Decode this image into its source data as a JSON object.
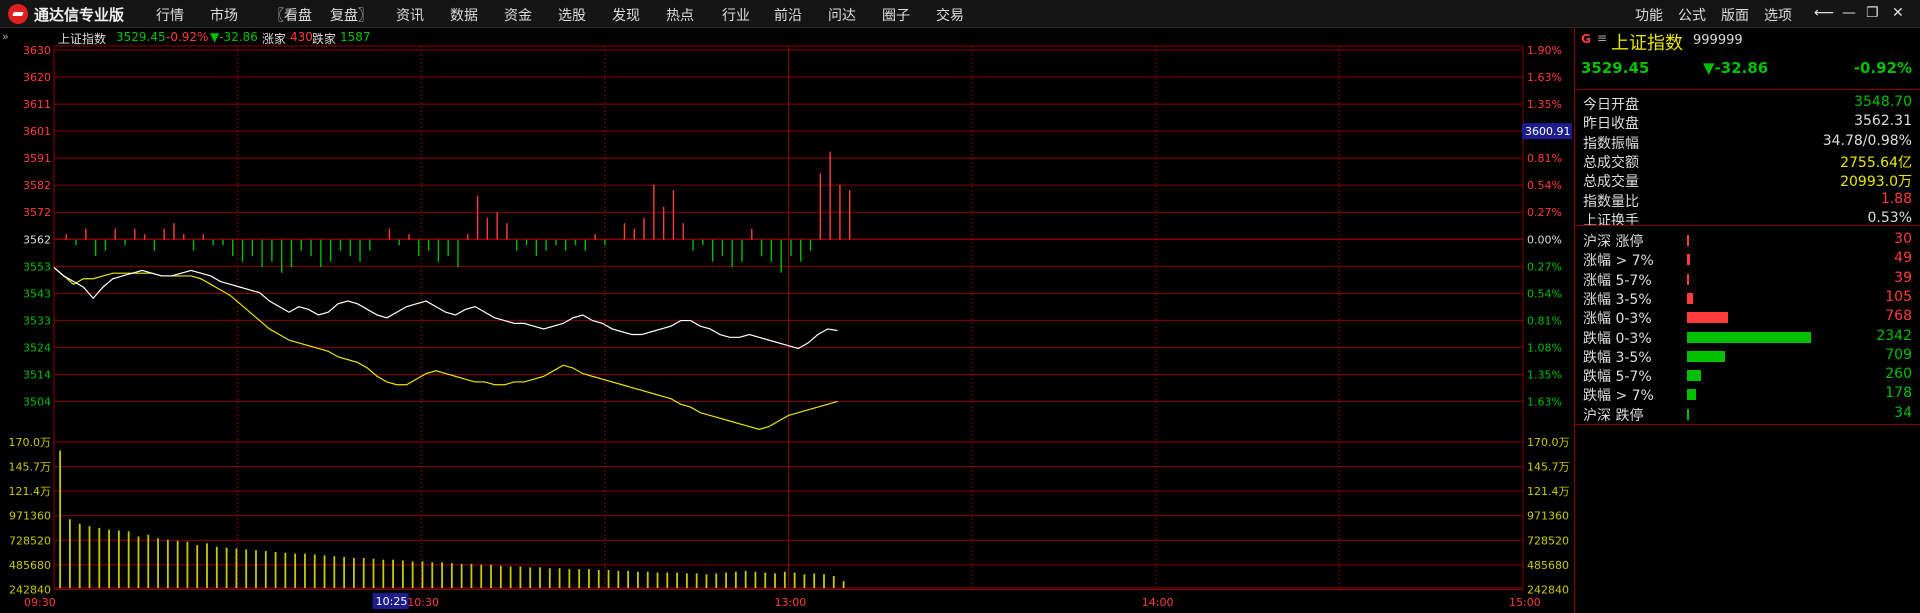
{
  "app": {
    "title": "通达信专业版"
  },
  "menu": [
    "行情",
    "市场",
    "〖看盘",
    "复盘〗",
    "资讯",
    "数据",
    "资金",
    "选股",
    "发现",
    "热点",
    "行业",
    "前沿",
    "问达",
    "圈子",
    "交易"
  ],
  "menu_right": [
    "功能",
    "公式",
    "版面",
    "选项"
  ],
  "chart_header": {
    "name": "上证指数",
    "price": "3529.45",
    "pct": "-0.92%",
    "change": "▼-32.86",
    "up_label": "涨家",
    "up_count": "430",
    "down_label": "跌家",
    "down_count": "1587"
  },
  "cursor_price": "3600.91",
  "cursor_time": "10:25",
  "colors": {
    "up": "#ff3b3b",
    "down": "#00c000",
    "grid": "#8b0000",
    "price_line": "#ffffff",
    "avg_line": "#e6e600",
    "volume": "#c8c800"
  },
  "chart_data": {
    "type": "line",
    "price_ticks": [
      3630,
      3620,
      3611,
      3601,
      3591,
      3582,
      3572,
      3562,
      3553,
      3543,
      3533,
      3524,
      3514,
      3504
    ],
    "pct_ticks": [
      "1.90%",
      "1.63%",
      "1.35%",
      "1.08%",
      "0.81%",
      "0.54%",
      "0.27%",
      "0.00%",
      "0.27%",
      "0.54%",
      "0.81%",
      "1.08%",
      "1.35%",
      "1.63%"
    ],
    "ylim": [
      3504,
      3630
    ],
    "prev_close": 3562,
    "volume_ticks_left": [
      "170.0万",
      "145.7万",
      "121.4万",
      "971360",
      "728520",
      "485680",
      "242840"
    ],
    "volume_ticks_right": [
      "170.0万",
      "145.7万",
      "121.4万",
      "971360",
      "728520",
      "485680",
      "242840"
    ],
    "time_labels": [
      "09:30",
      "10:30",
      "13:00",
      "14:00",
      "15:00"
    ],
    "price": [
      3552,
      3549,
      3547,
      3545,
      3541,
      3545,
      3548,
      3549,
      3550,
      3551,
      3550,
      3549,
      3549,
      3550,
      3551,
      3550,
      3549,
      3547,
      3546,
      3545,
      3544,
      3543,
      3540,
      3538,
      3536,
      3538,
      3537,
      3535,
      3536,
      3539,
      3540,
      3539,
      3537,
      3535,
      3534,
      3536,
      3538,
      3539,
      3540,
      3538,
      3536,
      3535,
      3537,
      3538,
      3536,
      3534,
      3533,
      3532,
      3532,
      3531,
      3530,
      3531,
      3532,
      3534,
      3535,
      3533,
      3532,
      3530,
      3529,
      3528,
      3528,
      3529,
      3530,
      3531,
      3533,
      3533,
      3531,
      3530,
      3528,
      3527,
      3527,
      3528,
      3527,
      3526,
      3525,
      3524,
      3523,
      3525,
      3528,
      3530,
      3529.45
    ],
    "avg": [
      3552,
      3549,
      3546,
      3548,
      3548,
      3549,
      3550,
      3550,
      3550,
      3550,
      3550,
      3549,
      3549,
      3549,
      3549,
      3548,
      3546,
      3544,
      3542,
      3539,
      3536,
      3533,
      3530,
      3528,
      3526,
      3525,
      3524,
      3523,
      3522,
      3520,
      3519,
      3518,
      3516,
      3513,
      3511,
      3510,
      3510,
      3512,
      3514,
      3515,
      3514,
      3513,
      3512,
      3511,
      3511,
      3510,
      3510,
      3511,
      3511,
      3512,
      3513,
      3515,
      3517,
      3516,
      3514,
      3513,
      3512,
      3511,
      3510,
      3509,
      3508,
      3507,
      3506,
      3505,
      3503,
      3502,
      3500,
      3499,
      3498,
      3497,
      3496,
      3495,
      3494,
      3495,
      3497,
      3499,
      3500,
      3501,
      3502,
      3503,
      3504
    ],
    "updown_bars": [
      1,
      -1,
      2,
      -3,
      -2,
      2,
      -1,
      2,
      1,
      -2,
      2,
      3,
      1,
      -2,
      1,
      -1,
      -1,
      -3,
      -4,
      -3,
      -5,
      -4,
      -6,
      -5,
      -2,
      -3,
      -5,
      -4,
      -2,
      -3,
      -4,
      -2,
      0,
      2,
      -1,
      1,
      -3,
      -2,
      -4,
      -3,
      -5,
      1,
      8,
      4,
      5,
      3,
      -2,
      -1,
      -3,
      -2,
      -1,
      -2,
      -1,
      -2,
      1,
      -1,
      0,
      3,
      2,
      4,
      10,
      6,
      9,
      3,
      -2,
      -1,
      -4,
      -3,
      -5,
      -4,
      2,
      -3,
      -4,
      -6,
      -3,
      -4,
      -2,
      12,
      16,
      10,
      9
    ],
    "volume": [
      160,
      80,
      75,
      72,
      70,
      68,
      67,
      66,
      60,
      62,
      58,
      56,
      55,
      54,
      50,
      52,
      48,
      47,
      46,
      45,
      44,
      43,
      42,
      41,
      40,
      40,
      39,
      38,
      37,
      36,
      35,
      35,
      34,
      33,
      33,
      32,
      31,
      31,
      30,
      30,
      29,
      28,
      28,
      27,
      27,
      26,
      25,
      25,
      24,
      24,
      23,
      23,
      22,
      22,
      22,
      21,
      21,
      20,
      20,
      19,
      19,
      18,
      18,
      18,
      17,
      17,
      16,
      17,
      18,
      19,
      20,
      19,
      18,
      17,
      19,
      18,
      16,
      17,
      16,
      14,
      8
    ]
  },
  "panel": {
    "marker": "G",
    "title": "上证指数",
    "code": "999999",
    "price": "3529.45",
    "change": "▼-32.86",
    "pct": "-0.92%",
    "stats": [
      {
        "label": "今日开盘",
        "value": "3548.70",
        "color": "#00c000"
      },
      {
        "label": "昨日收盘",
        "value": "3562.31",
        "color": "#dddddd"
      },
      {
        "label": "指数振幅",
        "value": "34.78/0.98%",
        "color": "#dddddd"
      },
      {
        "label": "总成交额",
        "value": "2755.64亿",
        "color": "#e6e600"
      },
      {
        "label": "总成交量",
        "value": "20993.0万",
        "color": "#e6e600"
      },
      {
        "label": "指数量比",
        "value": "1.88",
        "color": "#ff3b3b"
      },
      {
        "label": "上证换手",
        "value": "0.53%",
        "color": "#dddddd"
      }
    ],
    "dist": [
      {
        "label": "沪深 涨停",
        "value": "30",
        "color": "#ff3b3b",
        "ratio": 0.013
      },
      {
        "label": "涨幅 > 7%",
        "value": "49",
        "color": "#ff3b3b",
        "ratio": 0.021
      },
      {
        "label": "涨幅 5-7%",
        "value": "39",
        "color": "#ff3b3b",
        "ratio": 0.017
      },
      {
        "label": "涨幅 3-5%",
        "value": "105",
        "color": "#ff3b3b",
        "ratio": 0.045
      },
      {
        "label": "涨幅 0-3%",
        "value": "768",
        "color": "#ff3b3b",
        "ratio": 0.328
      },
      {
        "label": "跌幅 0-3%",
        "value": "2342",
        "color": "#00c000",
        "ratio": 1.0
      },
      {
        "label": "跌幅 3-5%",
        "value": "709",
        "color": "#00c000",
        "ratio": 0.303
      },
      {
        "label": "跌幅 5-7%",
        "value": "260",
        "color": "#00c000",
        "ratio": 0.111
      },
      {
        "label": "跌幅 > 7%",
        "value": "178",
        "color": "#00c000",
        "ratio": 0.076
      },
      {
        "label": "沪深 跌停",
        "value": "34",
        "color": "#00c000",
        "ratio": 0.015
      }
    ]
  }
}
